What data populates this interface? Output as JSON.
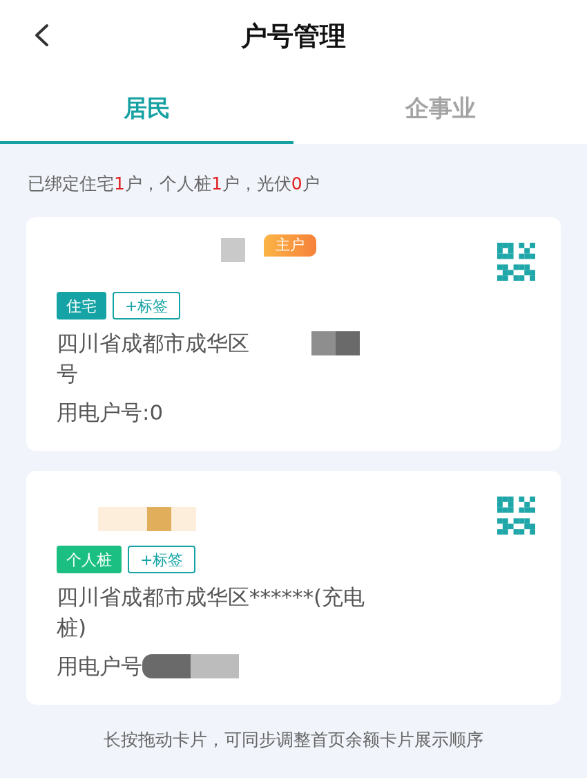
{
  "header": {
    "title": "户号管理"
  },
  "tabs": [
    {
      "label": "居民",
      "selected": true
    },
    {
      "label": "企事业",
      "selected": false
    }
  ],
  "summary": [
    {
      "kind": "text",
      "text": "已绑定住宅"
    },
    {
      "kind": "count",
      "text": "1"
    },
    {
      "kind": "text",
      "text": "户，个人桩"
    },
    {
      "kind": "count",
      "text": "1"
    },
    {
      "kind": "text",
      "text": "户，光伏"
    },
    {
      "kind": "count",
      "text": "0"
    },
    {
      "kind": "text",
      "text": "户"
    }
  ],
  "cards": [
    {
      "badge": "主户",
      "type_tag": {
        "kind": "residence",
        "label": "住宅"
      },
      "add_tag": "+标签",
      "address_lines": [
        "四川省成都市成华区",
        "号"
      ],
      "account": "用电户号:0"
    },
    {
      "type_tag": {
        "kind": "charger",
        "label": "个人桩"
      },
      "add_tag": "+标签",
      "address_lines": [
        "四川省成都市成华区******(充电",
        "桩)"
      ],
      "account": "用电户号"
    }
  ],
  "footer_note": "长按拖动卡片，可同步调整首页余额卡片展示顺序"
}
